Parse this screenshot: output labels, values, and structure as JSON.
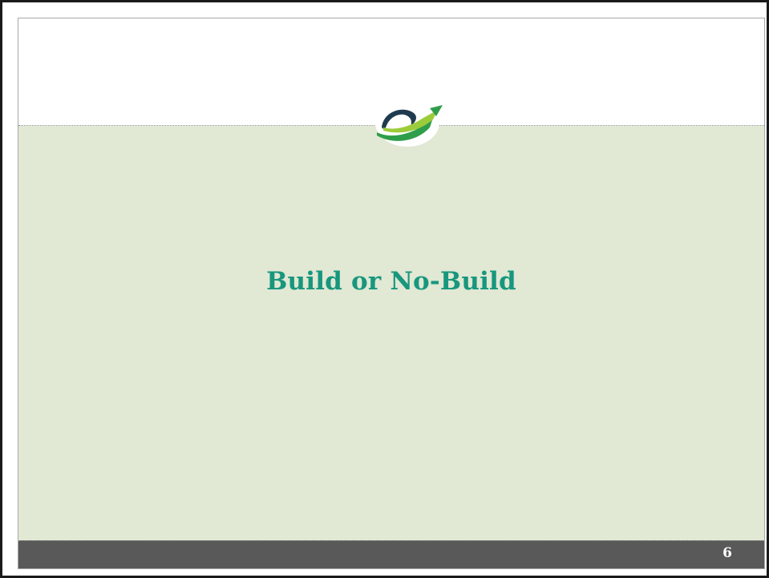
{
  "slide": {
    "title": "Build or No-Build",
    "number": "6"
  },
  "colors": {
    "title": "#17977d",
    "body_background": "#e1e8d4",
    "footer_background": "#595959",
    "logo_green_dark": "#2f9e4a",
    "logo_green_light": "#9ccc3b",
    "logo_navy": "#1f3b4d"
  },
  "icons": {
    "logo": "swoosh-logo-icon"
  }
}
